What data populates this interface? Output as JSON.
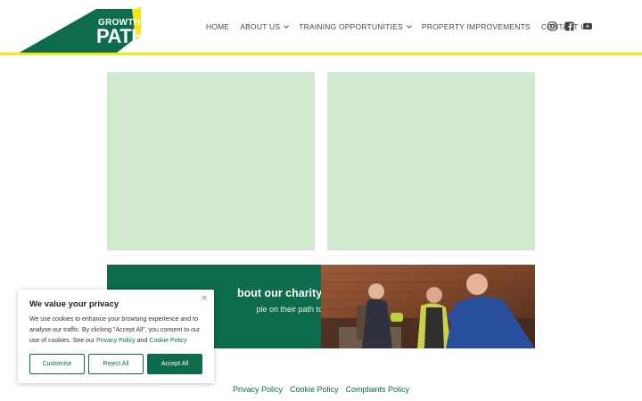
{
  "brand": {
    "logo_line1": "GROWTH",
    "logo_line2": "PATH",
    "colors": {
      "primary_green": "#0e6b4e",
      "accent_yellow": "#f6e71a",
      "light_green": "#d0e9cf"
    }
  },
  "nav": {
    "items": [
      {
        "label": "HOME",
        "has_dropdown": false
      },
      {
        "label": "ABOUT US",
        "has_dropdown": true
      },
      {
        "label": "TRAINING OPPORTUNITIES",
        "has_dropdown": true
      },
      {
        "label": "PROPERTY IMPROVEMENTS",
        "has_dropdown": false
      },
      {
        "label": "CONTACT US",
        "has_dropdown": false
      }
    ],
    "social_icons": [
      "instagram-icon",
      "facebook-icon",
      "youtube-icon"
    ]
  },
  "banner": {
    "title_visible": "bout our charity",
    "subtitle_visible": "ple on their path to"
  },
  "footer": {
    "links": [
      "Privacy Policy",
      "Cookie Policy",
      "Complaints Policy"
    ]
  },
  "cookie_dialog": {
    "title": "We value your privacy",
    "close_label": "×",
    "body_prefix": "We use cookies to enhance your browsing experience and to analyse our traffic. By clicking \"Accept All\", you consent to our use of cookies. See our ",
    "privacy_link": "Privacy Policy",
    "and_text": " and ",
    "cookie_link": "Cookie Policy",
    "buttons": {
      "customise": "Customise",
      "reject": "Reject All",
      "accept": "Accept All"
    }
  }
}
